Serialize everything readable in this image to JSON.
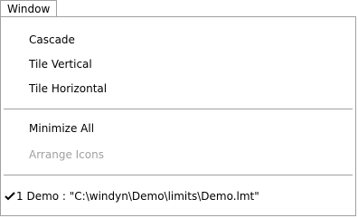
{
  "menubar": {
    "title": "Window"
  },
  "menu": {
    "items": [
      {
        "label": "Cascade"
      },
      {
        "label": "Tile Vertical"
      },
      {
        "label": "Tile Horizontal"
      },
      {
        "label": "Minimize All"
      },
      {
        "label": "Arrange Icons",
        "disabled": true
      },
      {
        "label": "1 Demo  :  \"C:\\windyn\\Demo\\limits\\Demo.lmt\"",
        "checked": true
      }
    ]
  },
  "icons": {
    "check": "check-mark-icon"
  },
  "colors": {
    "disabled_text": "#a0a0a0",
    "border": "#a0a0a0"
  }
}
